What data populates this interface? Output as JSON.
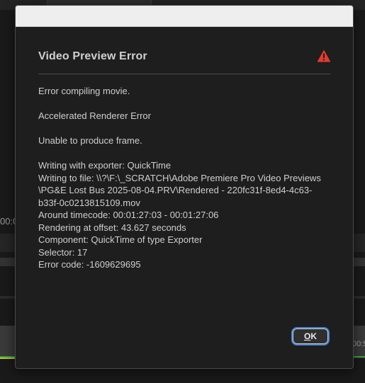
{
  "background": {
    "timecode_left": "00:0",
    "timecode_right": "00:5"
  },
  "dialog": {
    "title": "Video Preview Error",
    "icon": "warning-triangle-icon",
    "accent_color": "#e23b30",
    "messages": {
      "line1": "Error compiling movie.",
      "line2": "Accelerated Renderer Error",
      "line3": "Unable to produce frame.",
      "details": [
        "Writing with exporter: QuickTime",
        "Writing to file: \\\\?\\F:\\_SCRATCH\\Adobe Premiere Pro Video Previews",
        "\\PG&E Lost Bus 2025-08-04.PRV\\Rendered - 220fc31f-8ed4-4c63-",
        "b33f-0c0213815109.mov",
        "Around timecode: 00:01:27:03 - 00:01:27:06",
        "Rendering at offset: 43.627 seconds",
        "Component: QuickTime of type Exporter",
        "Selector: 17",
        "Error code: -1609629695"
      ]
    },
    "ok_button": {
      "mnemonic": "O",
      "rest": "K"
    }
  }
}
